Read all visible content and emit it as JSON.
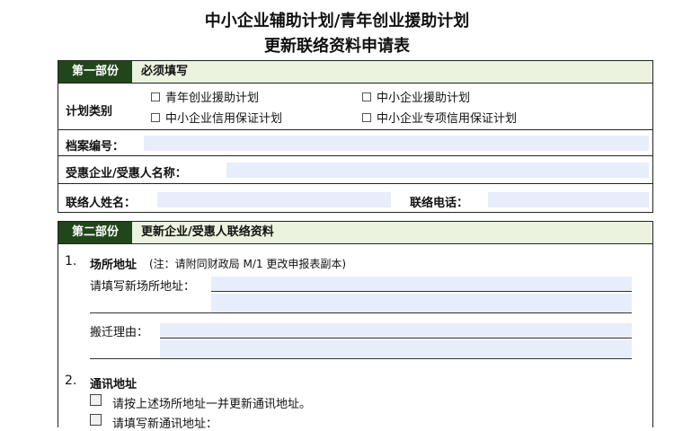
{
  "header": {
    "title_line1": "中小企业辅助计划/青年创业援助计划",
    "title_line2": "更新联络资料申请表"
  },
  "part1": {
    "tag": "第一部份",
    "label": "必须填写",
    "plan_type_label": "计划类别",
    "options": [
      "青年创业援助计划",
      "中小企业援助计划",
      "中小企业信用保证计划",
      "中小企业专项信用保证计划"
    ],
    "file_no_label": "档案编号：",
    "company_label": "受惠企业/受惠人名称：",
    "contact_name_label": "联络人姓名：",
    "phone_label": "联络电话："
  },
  "part2": {
    "tag": "第二部份",
    "label": "更新企业/受惠人联络资料",
    "item1": {
      "num": "1.",
      "title": "场所地址",
      "note": "(注：请附同财政局 M/1 更改申报表副本)",
      "new_address_label": "请填写新场所地址：",
      "reason_label": "搬迁理由："
    },
    "item2": {
      "num": "2.",
      "title": "通讯地址",
      "same_as_label": "请按上述场所地址一并更新通讯地址。",
      "fill_label": "请填写新通讯地址："
    }
  },
  "colors": {
    "tag_bg": "#22461b",
    "head_bg": "#ebf3df",
    "field_bg": "#e7edfa"
  }
}
